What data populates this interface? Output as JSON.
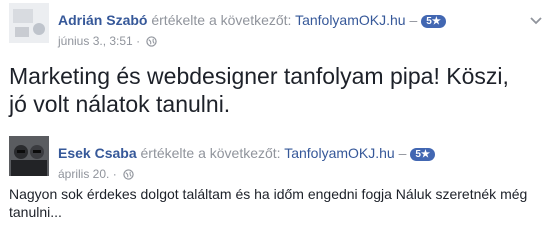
{
  "reviews": [
    {
      "name": "Adrián Szabó",
      "verb": "értékelte a következőt:",
      "page": "TanfolyamOKJ.hu",
      "dash": "–",
      "rating": "5★",
      "date": "június 3., 3:51",
      "sep": "·",
      "text": "Marketing és webdesigner tanfolyam pipa! Köszi, jó volt nálatok tanulni."
    },
    {
      "name": "Esek Csaba",
      "verb": "értékelte a következőt:",
      "page": "TanfolyamOKJ.hu",
      "dash": "–",
      "rating": "5★",
      "date": "április 20.",
      "sep": "·",
      "text": "Nagyon sok érdekes dolgot találtam és ha időm engedni fogja Náluk szeretnék még tanulni..."
    }
  ],
  "icons": [
    "globe-icon",
    "chevron-down-icon"
  ],
  "colors": {
    "link": "#365899",
    "meta": "#90949c",
    "badge": "#4267b2",
    "text": "#1d2129"
  }
}
